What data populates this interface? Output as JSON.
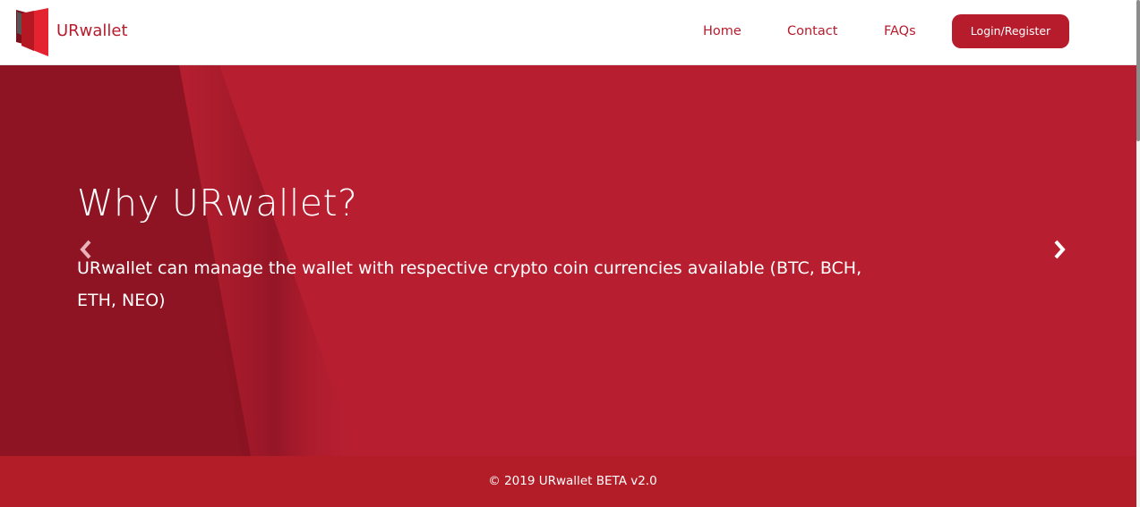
{
  "header": {
    "brand": "URwallet",
    "nav": {
      "home": "Home",
      "contact": "Contact",
      "faqs": "FAQs",
      "login": "Login/Register"
    }
  },
  "hero": {
    "title": "Why URwallet?",
    "description": "URwallet can manage the wallet with respective crypto coin currencies available (BTC, BCH, ETH, NEO)",
    "prev_icon": "chevron-left-icon",
    "next_icon": "chevron-right-icon"
  },
  "footer": {
    "copyright": "© 2019 URwallet BETA v2.0"
  },
  "colors": {
    "brand": "#b71c2d",
    "hero": "#b71f30",
    "hero_dark": "#8e1423",
    "footer": "#b31d27"
  }
}
